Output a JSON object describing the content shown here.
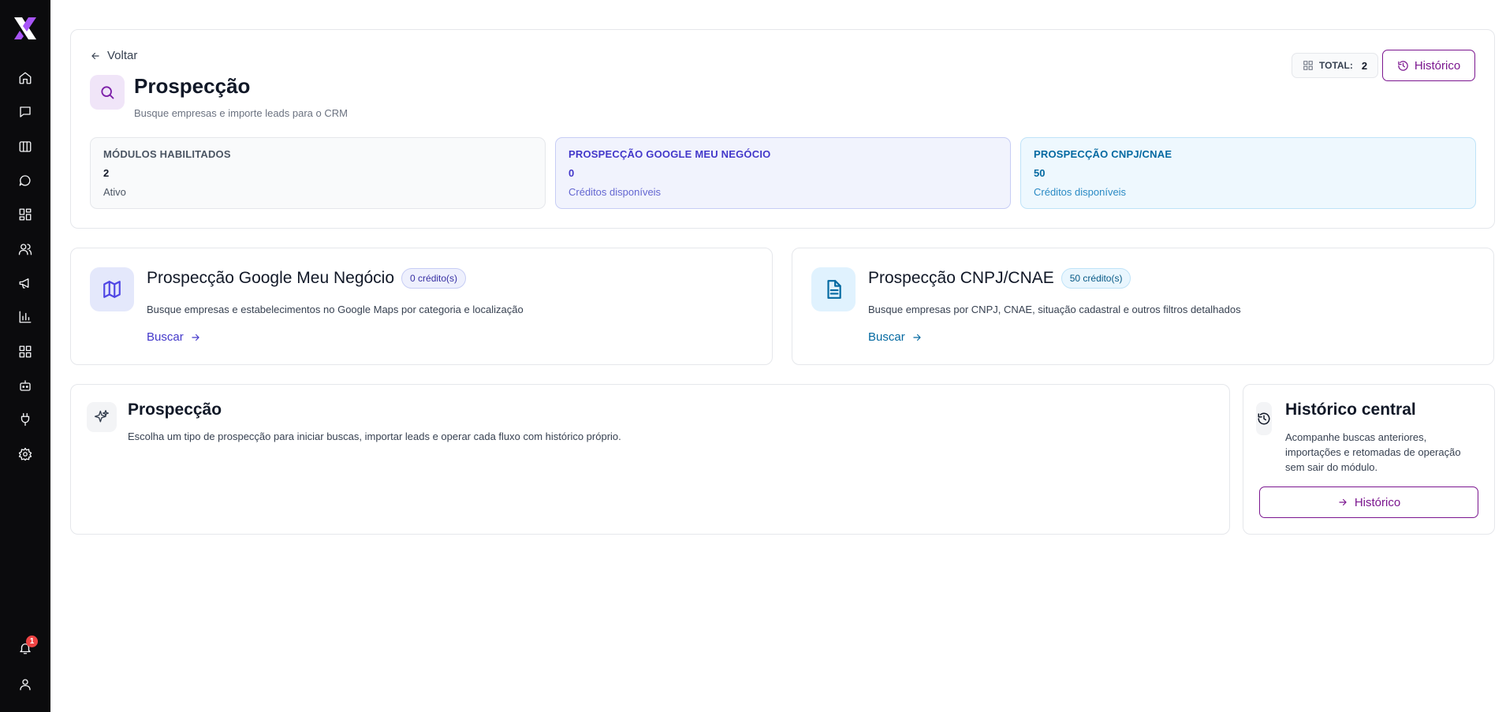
{
  "sidebar": {
    "logo": "brand-x-logo",
    "items": [
      {
        "icon": "home-icon"
      },
      {
        "icon": "message-square-icon"
      },
      {
        "icon": "columns-icon"
      },
      {
        "icon": "chat-bubble-icon"
      },
      {
        "icon": "grid-icon"
      },
      {
        "icon": "users-icon"
      },
      {
        "icon": "megaphone-icon"
      },
      {
        "icon": "bar-chart-icon"
      },
      {
        "icon": "apps-icon"
      },
      {
        "icon": "bot-icon"
      },
      {
        "icon": "plug-icon"
      },
      {
        "icon": "gear-icon"
      }
    ],
    "notifications_count": "1",
    "bottom_items": [
      {
        "icon": "bell-icon"
      },
      {
        "icon": "user-icon"
      }
    ]
  },
  "header": {
    "back_label": "Voltar",
    "title": "Prospecção",
    "subtitle": "Busque empresas e importe leads para o CRM",
    "total_label": "TOTAL:",
    "total_value": "2",
    "history_button": "Histórico"
  },
  "stats": [
    {
      "label": "MÓDULOS HABILITADOS",
      "value": "2",
      "sub": "Ativo"
    },
    {
      "label": "PROSPECÇÃO GOOGLE MEU NEGÓCIO",
      "value": "0",
      "sub": "Créditos disponíveis"
    },
    {
      "label": "PROSPECÇÃO CNPJ/CNAE",
      "value": "50",
      "sub": "Créditos disponíveis"
    }
  ],
  "modules": [
    {
      "title": "Prospecção Google Meu Negócio",
      "credits": "0 crédito(s)",
      "description": "Busque empresas e estabelecimentos no Google Maps por categoria e localização",
      "link": "Buscar"
    },
    {
      "title": "Prospecção CNPJ/CNAE",
      "credits": "50 crédito(s)",
      "description": "Busque empresas por CNPJ, CNAE, situação cadastral e outros filtros detalhados",
      "link": "Buscar"
    }
  ],
  "info": {
    "title": "Prospecção",
    "description": "Escolha um tipo de prospecção para iniciar buscas, importar leads e operar cada fluxo com histórico próprio."
  },
  "history_central": {
    "title": "Histórico central",
    "description": "Acompanhe buscas anteriores, importações e retomadas de operação sem sair do módulo.",
    "button": "Histórico"
  },
  "colors": {
    "sidebar_bg": "#0b0b0d",
    "brand_purple": "#7b168f",
    "google_accent": "#4338ca",
    "cnpj_accent": "#0369a1"
  }
}
